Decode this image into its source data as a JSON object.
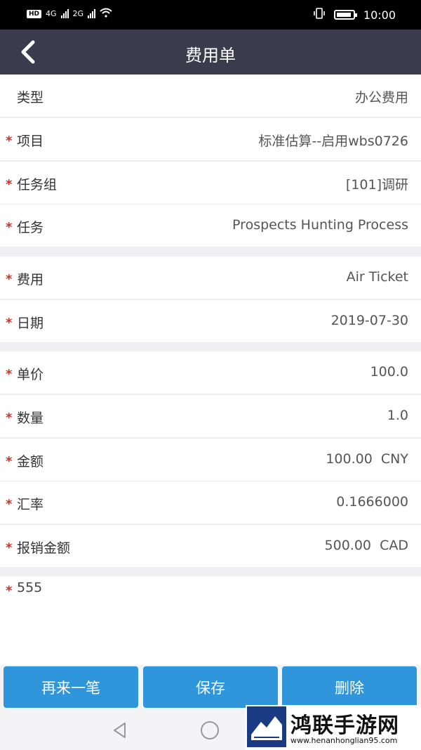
{
  "status_bar": {
    "network_4g": "4G",
    "network_2g": "2G",
    "time": "10:00"
  },
  "header": {
    "title": "费用单"
  },
  "form": {
    "rows": [
      {
        "label": "类型",
        "value": "办公费用",
        "required": false
      },
      {
        "label": "项目",
        "value": "标准估算--启用wbs0726",
        "required": true
      },
      {
        "label": "任务组",
        "value": "[101]调研",
        "required": true
      },
      {
        "label": "任务",
        "value": "Prospects Hunting Process",
        "required": true
      },
      {
        "label": "费用",
        "value": "Air Ticket",
        "required": true
      },
      {
        "label": "日期",
        "value": "2019-07-30",
        "required": true
      },
      {
        "label": "单价",
        "value": "100.0",
        "required": true
      },
      {
        "label": "数量",
        "value": "1.0",
        "required": true
      },
      {
        "label": "金额",
        "value": "100.00  CNY",
        "required": true
      },
      {
        "label": "汇率",
        "value": "0.1666000",
        "required": true
      },
      {
        "label": "报销金额",
        "value": "500.00  CAD",
        "required": true
      }
    ],
    "memo": "555"
  },
  "actions": {
    "again_label": "再来一笔",
    "save_label": "保存",
    "delete_label": "删除"
  },
  "watermark": {
    "title": "鸿联手游网",
    "url": "www.henanhonglian95.com"
  },
  "colors": {
    "nav_bg": "#3b3b4d",
    "button_bg": "#2f96dc",
    "required_star": "#c0392b"
  }
}
